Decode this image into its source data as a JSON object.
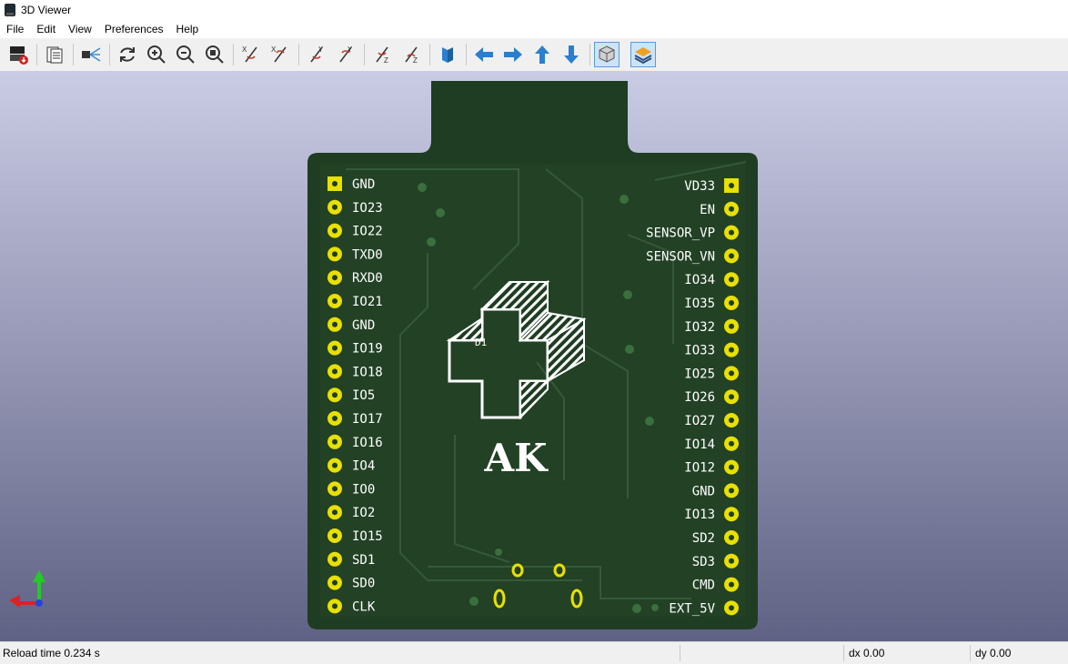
{
  "window": {
    "title": "3D Viewer"
  },
  "menu": {
    "file": "File",
    "edit": "Edit",
    "view": "View",
    "preferences": "Preferences",
    "help": "Help"
  },
  "board": {
    "logo_text": "AK",
    "ref_label": "D1",
    "left_pins": [
      "GND",
      "IO23",
      "IO22",
      "TXD0",
      "RXD0",
      "IO21",
      "GND",
      "IO19",
      "IO18",
      "IO5",
      "IO17",
      "IO16",
      "IO4",
      "IO0",
      "IO2",
      "IO15",
      "SD1",
      "SD0",
      "CLK"
    ],
    "right_pins": [
      "VD33",
      "EN",
      "SENSOR_VP",
      "SENSOR_VN",
      "IO34",
      "IO35",
      "IO32",
      "IO33",
      "IO25",
      "IO26",
      "IO27",
      "IO14",
      "IO12",
      "GND",
      "IO13",
      "SD2",
      "SD3",
      "CMD",
      "EXT_5V"
    ]
  },
  "status": {
    "reload": "Reload time 0.234 s",
    "dx": "dx 0.00",
    "dy": "dy 0.00"
  },
  "colors": {
    "pcb": "#1e3d22",
    "silk": "#ffffff",
    "pad": "#e8e000",
    "viewport_top": "#cacbe4",
    "viewport_bottom": "#5f6284"
  }
}
